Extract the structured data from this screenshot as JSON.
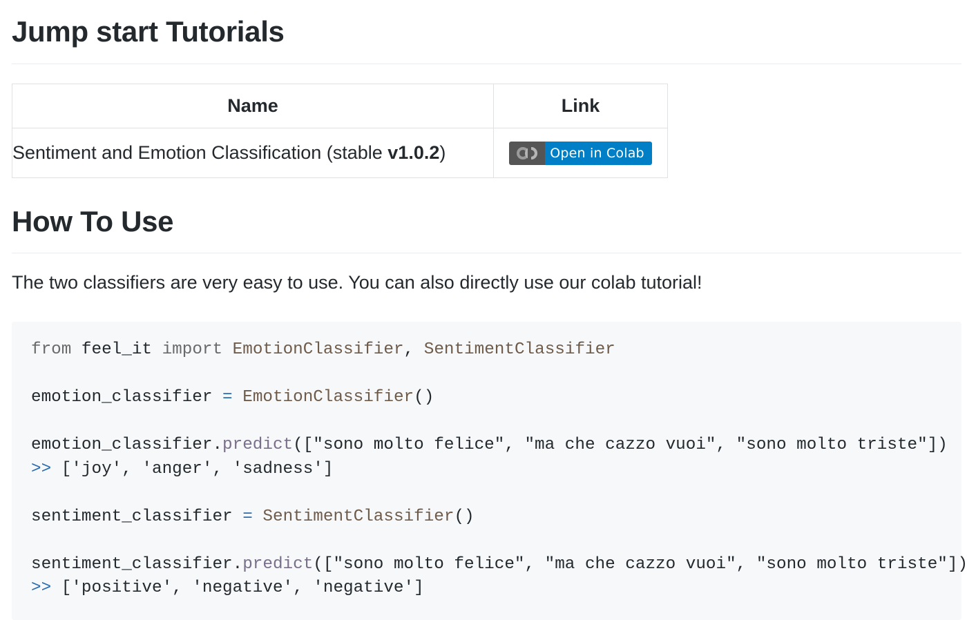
{
  "tutorials": {
    "heading": "Jump start Tutorials",
    "table": {
      "headers": [
        "Name",
        "Link"
      ],
      "rows": [
        {
          "name": "Sentiment and Emotion Classification (stable ",
          "name_version": "v1.0.2",
          "name_suffix": ")",
          "badge": {
            "logo_text": "CO",
            "label": "Open in Colab"
          }
        }
      ]
    }
  },
  "how_to_use": {
    "heading": "How To Use",
    "intro": "The two classifiers are very easy to use. You can also directly use our colab tutorial!"
  },
  "code": {
    "line1": {
      "from": "from",
      "module": "feel_it",
      "import": "import",
      "cls1": "EmotionClassifier",
      "comma": ",",
      "cls2": "SentimentClassifier"
    },
    "line2": {
      "var": "emotion_classifier",
      "eq": "=",
      "cls": "EmotionClassifier",
      "call": "()"
    },
    "line3": {
      "obj": "emotion_classifier",
      "dot": ".",
      "method": "predict",
      "args": "([\"sono molto felice\", \"ma che cazzo vuoi\", \"sono molto triste\"])"
    },
    "line4": {
      "prompt": ">>",
      "output": "['joy', 'anger', 'sadness']"
    },
    "line5": {
      "var": "sentiment_classifier",
      "eq": "=",
      "cls": "SentimentClassifier",
      "call": "()"
    },
    "line6": {
      "obj": "sentiment_classifier",
      "dot": ".",
      "method": "predict",
      "args": "([\"sono molto felice\", \"ma che cazzo vuoi\", \"sono molto triste\"])"
    },
    "line7": {
      "prompt": ">>",
      "output": "['positive', 'negative', 'negative']"
    }
  },
  "colors": {
    "heading_text": "#24292e",
    "rule": "#eaecef",
    "badge_left": "#555555",
    "badge_right": "#007ec6",
    "code_background": "#f6f8fa"
  }
}
